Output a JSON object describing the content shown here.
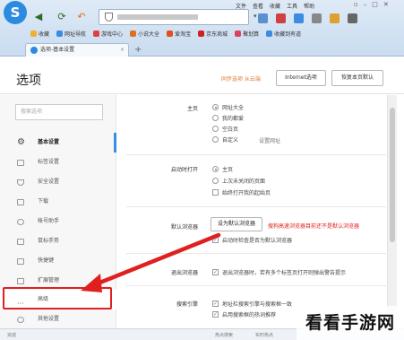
{
  "browser": {
    "menu": [
      "文件",
      "查看",
      "收藏",
      "工具",
      "帮助"
    ],
    "bookmarks": [
      {
        "label": "收藏",
        "color": "#f0b030"
      },
      {
        "label": "网址导航",
        "color": "#3a8de0"
      },
      {
        "label": "游戏中心",
        "color": "#e04040"
      },
      {
        "label": "小说大全",
        "color": "#e07020"
      },
      {
        "label": "爱淘宝",
        "color": "#e05020"
      },
      {
        "label": "京东商城",
        "color": "#d02020"
      },
      {
        "label": "聚划算",
        "color": "#e04060"
      },
      {
        "label": "收藏到有道",
        "color": "#3a8de0"
      }
    ],
    "tab_title": "选项-基本设置",
    "tab_close": "×",
    "new_tab": "+"
  },
  "page": {
    "title": "选项",
    "sync_note": "同步选项  从云端",
    "internet_options_button": "Internet选项",
    "restore_defaults_button": "恢复本页默认"
  },
  "sidebar": {
    "search_placeholder": "搜索选项",
    "items": [
      {
        "label": "基本设置",
        "active": true
      },
      {
        "label": "标签设置"
      },
      {
        "label": "安全设置"
      },
      {
        "label": "下载"
      },
      {
        "label": "帐号助手"
      },
      {
        "label": "鼠标手势"
      },
      {
        "label": "快捷键"
      },
      {
        "label": "扩展管理"
      },
      {
        "label": "高级",
        "highlight": true
      },
      {
        "label": "其他设置"
      }
    ]
  },
  "settings": {
    "homepage": {
      "label": "主页",
      "options": [
        "网址大全",
        "我的都爱",
        "空白页",
        "自定义"
      ],
      "selected": 0,
      "custom_link": "设置网址"
    },
    "startup": {
      "label": "启动时打开",
      "options": [
        "主页",
        "上次未关闭的页面"
      ],
      "selected": 0,
      "extra_checkbox": "始终打开我的起始页"
    },
    "default_browser": {
      "label": "默认浏览器",
      "button": "设为默认浏览器",
      "note": "搜狗高速浏览器目前还不是默认浏览器",
      "checkbox": "启动时检查是否为默认浏览器"
    },
    "exit": {
      "label": "退出浏览器",
      "checkbox": "退出浏览器时，若有多个标签页打开则弹出警告提示"
    },
    "search": {
      "label": "搜索引擎",
      "checkbox1": "地址栏搜索引擎与搜索框一致",
      "checkbox2": "启用搜索框的热词推荐"
    }
  },
  "status_bar": {
    "items": [
      "完成",
      "热点搜索",
      "实时热点"
    ]
  },
  "watermark": "看看手游网"
}
